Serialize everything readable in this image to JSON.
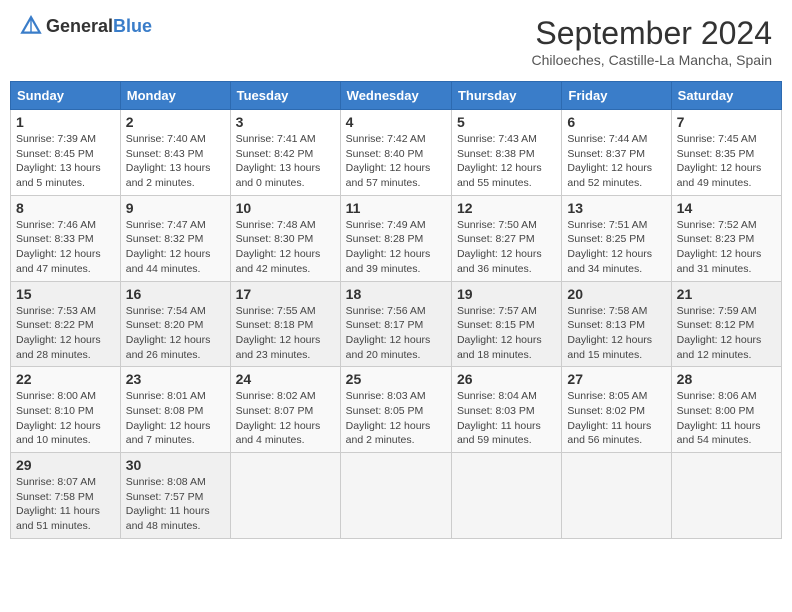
{
  "header": {
    "logo_general": "General",
    "logo_blue": "Blue",
    "main_title": "September 2024",
    "subtitle": "Chiloeches, Castille-La Mancha, Spain"
  },
  "weekdays": [
    "Sunday",
    "Monday",
    "Tuesday",
    "Wednesday",
    "Thursday",
    "Friday",
    "Saturday"
  ],
  "weeks": [
    [
      {
        "day": "1",
        "info": "Sunrise: 7:39 AM\nSunset: 8:45 PM\nDaylight: 13 hours\nand 5 minutes."
      },
      {
        "day": "2",
        "info": "Sunrise: 7:40 AM\nSunset: 8:43 PM\nDaylight: 13 hours\nand 2 minutes."
      },
      {
        "day": "3",
        "info": "Sunrise: 7:41 AM\nSunset: 8:42 PM\nDaylight: 13 hours\nand 0 minutes."
      },
      {
        "day": "4",
        "info": "Sunrise: 7:42 AM\nSunset: 8:40 PM\nDaylight: 12 hours\nand 57 minutes."
      },
      {
        "day": "5",
        "info": "Sunrise: 7:43 AM\nSunset: 8:38 PM\nDaylight: 12 hours\nand 55 minutes."
      },
      {
        "day": "6",
        "info": "Sunrise: 7:44 AM\nSunset: 8:37 PM\nDaylight: 12 hours\nand 52 minutes."
      },
      {
        "day": "7",
        "info": "Sunrise: 7:45 AM\nSunset: 8:35 PM\nDaylight: 12 hours\nand 49 minutes."
      }
    ],
    [
      {
        "day": "8",
        "info": "Sunrise: 7:46 AM\nSunset: 8:33 PM\nDaylight: 12 hours\nand 47 minutes."
      },
      {
        "day": "9",
        "info": "Sunrise: 7:47 AM\nSunset: 8:32 PM\nDaylight: 12 hours\nand 44 minutes."
      },
      {
        "day": "10",
        "info": "Sunrise: 7:48 AM\nSunset: 8:30 PM\nDaylight: 12 hours\nand 42 minutes."
      },
      {
        "day": "11",
        "info": "Sunrise: 7:49 AM\nSunset: 8:28 PM\nDaylight: 12 hours\nand 39 minutes."
      },
      {
        "day": "12",
        "info": "Sunrise: 7:50 AM\nSunset: 8:27 PM\nDaylight: 12 hours\nand 36 minutes."
      },
      {
        "day": "13",
        "info": "Sunrise: 7:51 AM\nSunset: 8:25 PM\nDaylight: 12 hours\nand 34 minutes."
      },
      {
        "day": "14",
        "info": "Sunrise: 7:52 AM\nSunset: 8:23 PM\nDaylight: 12 hours\nand 31 minutes."
      }
    ],
    [
      {
        "day": "15",
        "info": "Sunrise: 7:53 AM\nSunset: 8:22 PM\nDaylight: 12 hours\nand 28 minutes."
      },
      {
        "day": "16",
        "info": "Sunrise: 7:54 AM\nSunset: 8:20 PM\nDaylight: 12 hours\nand 26 minutes."
      },
      {
        "day": "17",
        "info": "Sunrise: 7:55 AM\nSunset: 8:18 PM\nDaylight: 12 hours\nand 23 minutes."
      },
      {
        "day": "18",
        "info": "Sunrise: 7:56 AM\nSunset: 8:17 PM\nDaylight: 12 hours\nand 20 minutes."
      },
      {
        "day": "19",
        "info": "Sunrise: 7:57 AM\nSunset: 8:15 PM\nDaylight: 12 hours\nand 18 minutes."
      },
      {
        "day": "20",
        "info": "Sunrise: 7:58 AM\nSunset: 8:13 PM\nDaylight: 12 hours\nand 15 minutes."
      },
      {
        "day": "21",
        "info": "Sunrise: 7:59 AM\nSunset: 8:12 PM\nDaylight: 12 hours\nand 12 minutes."
      }
    ],
    [
      {
        "day": "22",
        "info": "Sunrise: 8:00 AM\nSunset: 8:10 PM\nDaylight: 12 hours\nand 10 minutes."
      },
      {
        "day": "23",
        "info": "Sunrise: 8:01 AM\nSunset: 8:08 PM\nDaylight: 12 hours\nand 7 minutes."
      },
      {
        "day": "24",
        "info": "Sunrise: 8:02 AM\nSunset: 8:07 PM\nDaylight: 12 hours\nand 4 minutes."
      },
      {
        "day": "25",
        "info": "Sunrise: 8:03 AM\nSunset: 8:05 PM\nDaylight: 12 hours\nand 2 minutes."
      },
      {
        "day": "26",
        "info": "Sunrise: 8:04 AM\nSunset: 8:03 PM\nDaylight: 11 hours\nand 59 minutes."
      },
      {
        "day": "27",
        "info": "Sunrise: 8:05 AM\nSunset: 8:02 PM\nDaylight: 11 hours\nand 56 minutes."
      },
      {
        "day": "28",
        "info": "Sunrise: 8:06 AM\nSunset: 8:00 PM\nDaylight: 11 hours\nand 54 minutes."
      }
    ],
    [
      {
        "day": "29",
        "info": "Sunrise: 8:07 AM\nSunset: 7:58 PM\nDaylight: 11 hours\nand 51 minutes."
      },
      {
        "day": "30",
        "info": "Sunrise: 8:08 AM\nSunset: 7:57 PM\nDaylight: 11 hours\nand 48 minutes."
      },
      null,
      null,
      null,
      null,
      null
    ]
  ]
}
